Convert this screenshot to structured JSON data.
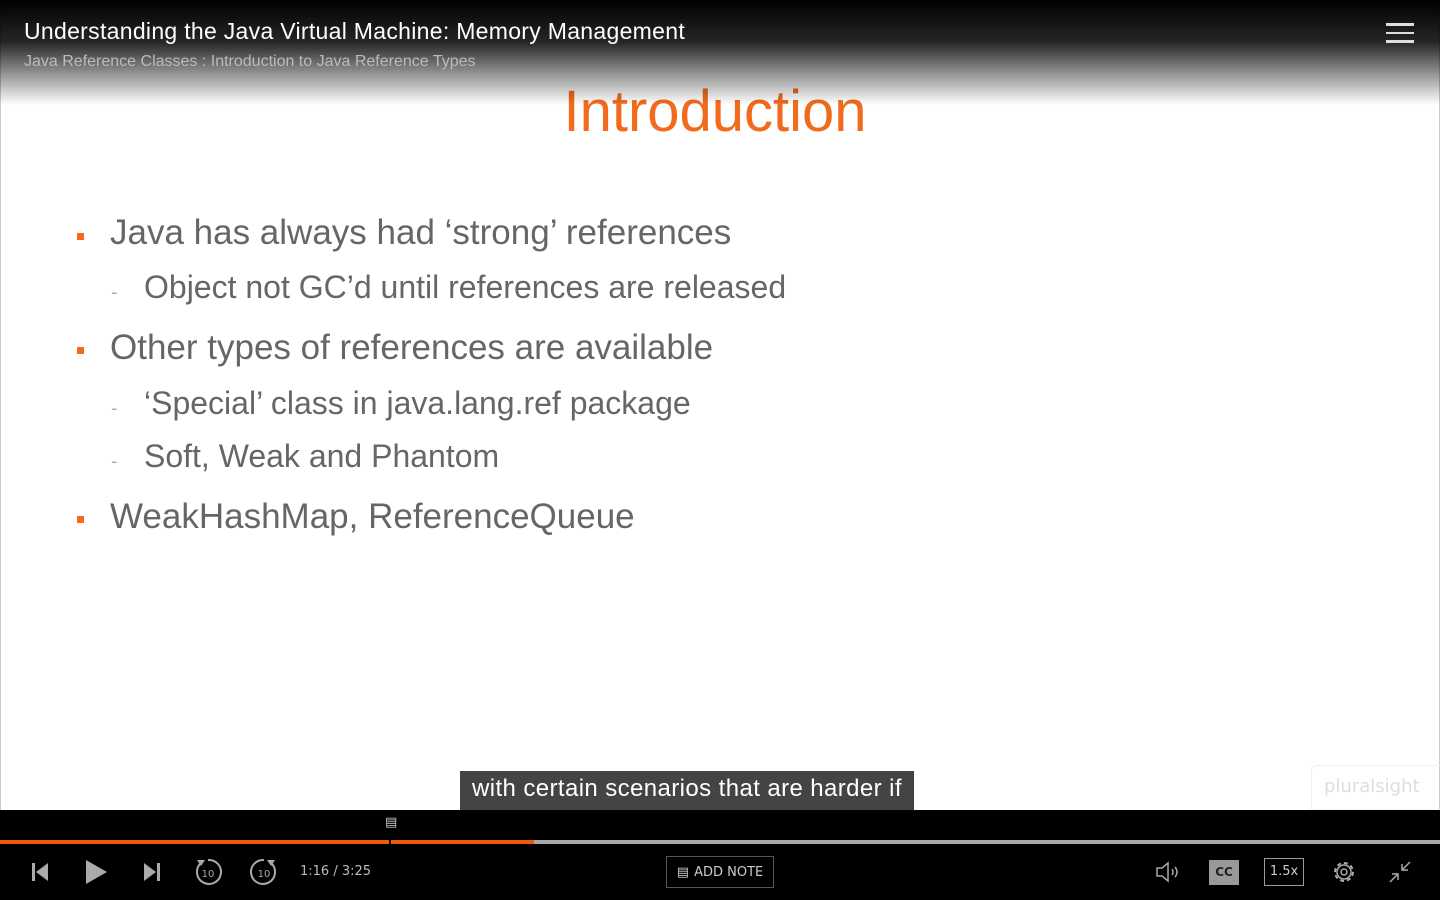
{
  "header": {
    "title": "Understanding the Java Virtual Machine: Memory Management",
    "subtitle": "Java Reference Classes : Introduction to Java Reference Types"
  },
  "slide": {
    "title": "Introduction",
    "bullets": [
      "Java has always had  ‘strong’ references",
      "Object not GC’d until references are released",
      "Other types of references are available",
      "‘Special’ class in java.lang.ref package",
      "Soft, Weak and Phantom",
      "WeakHashMap, ReferenceQueue"
    ],
    "logo": "pluralsight"
  },
  "caption": "with certain scenarios that are harder if",
  "player": {
    "time": "1:16 / 3:25",
    "progress_fraction": 0.3707,
    "add_note": "ADD NOTE",
    "cc": "CC",
    "speed": "1.5x",
    "accent": "#f15a0a"
  }
}
